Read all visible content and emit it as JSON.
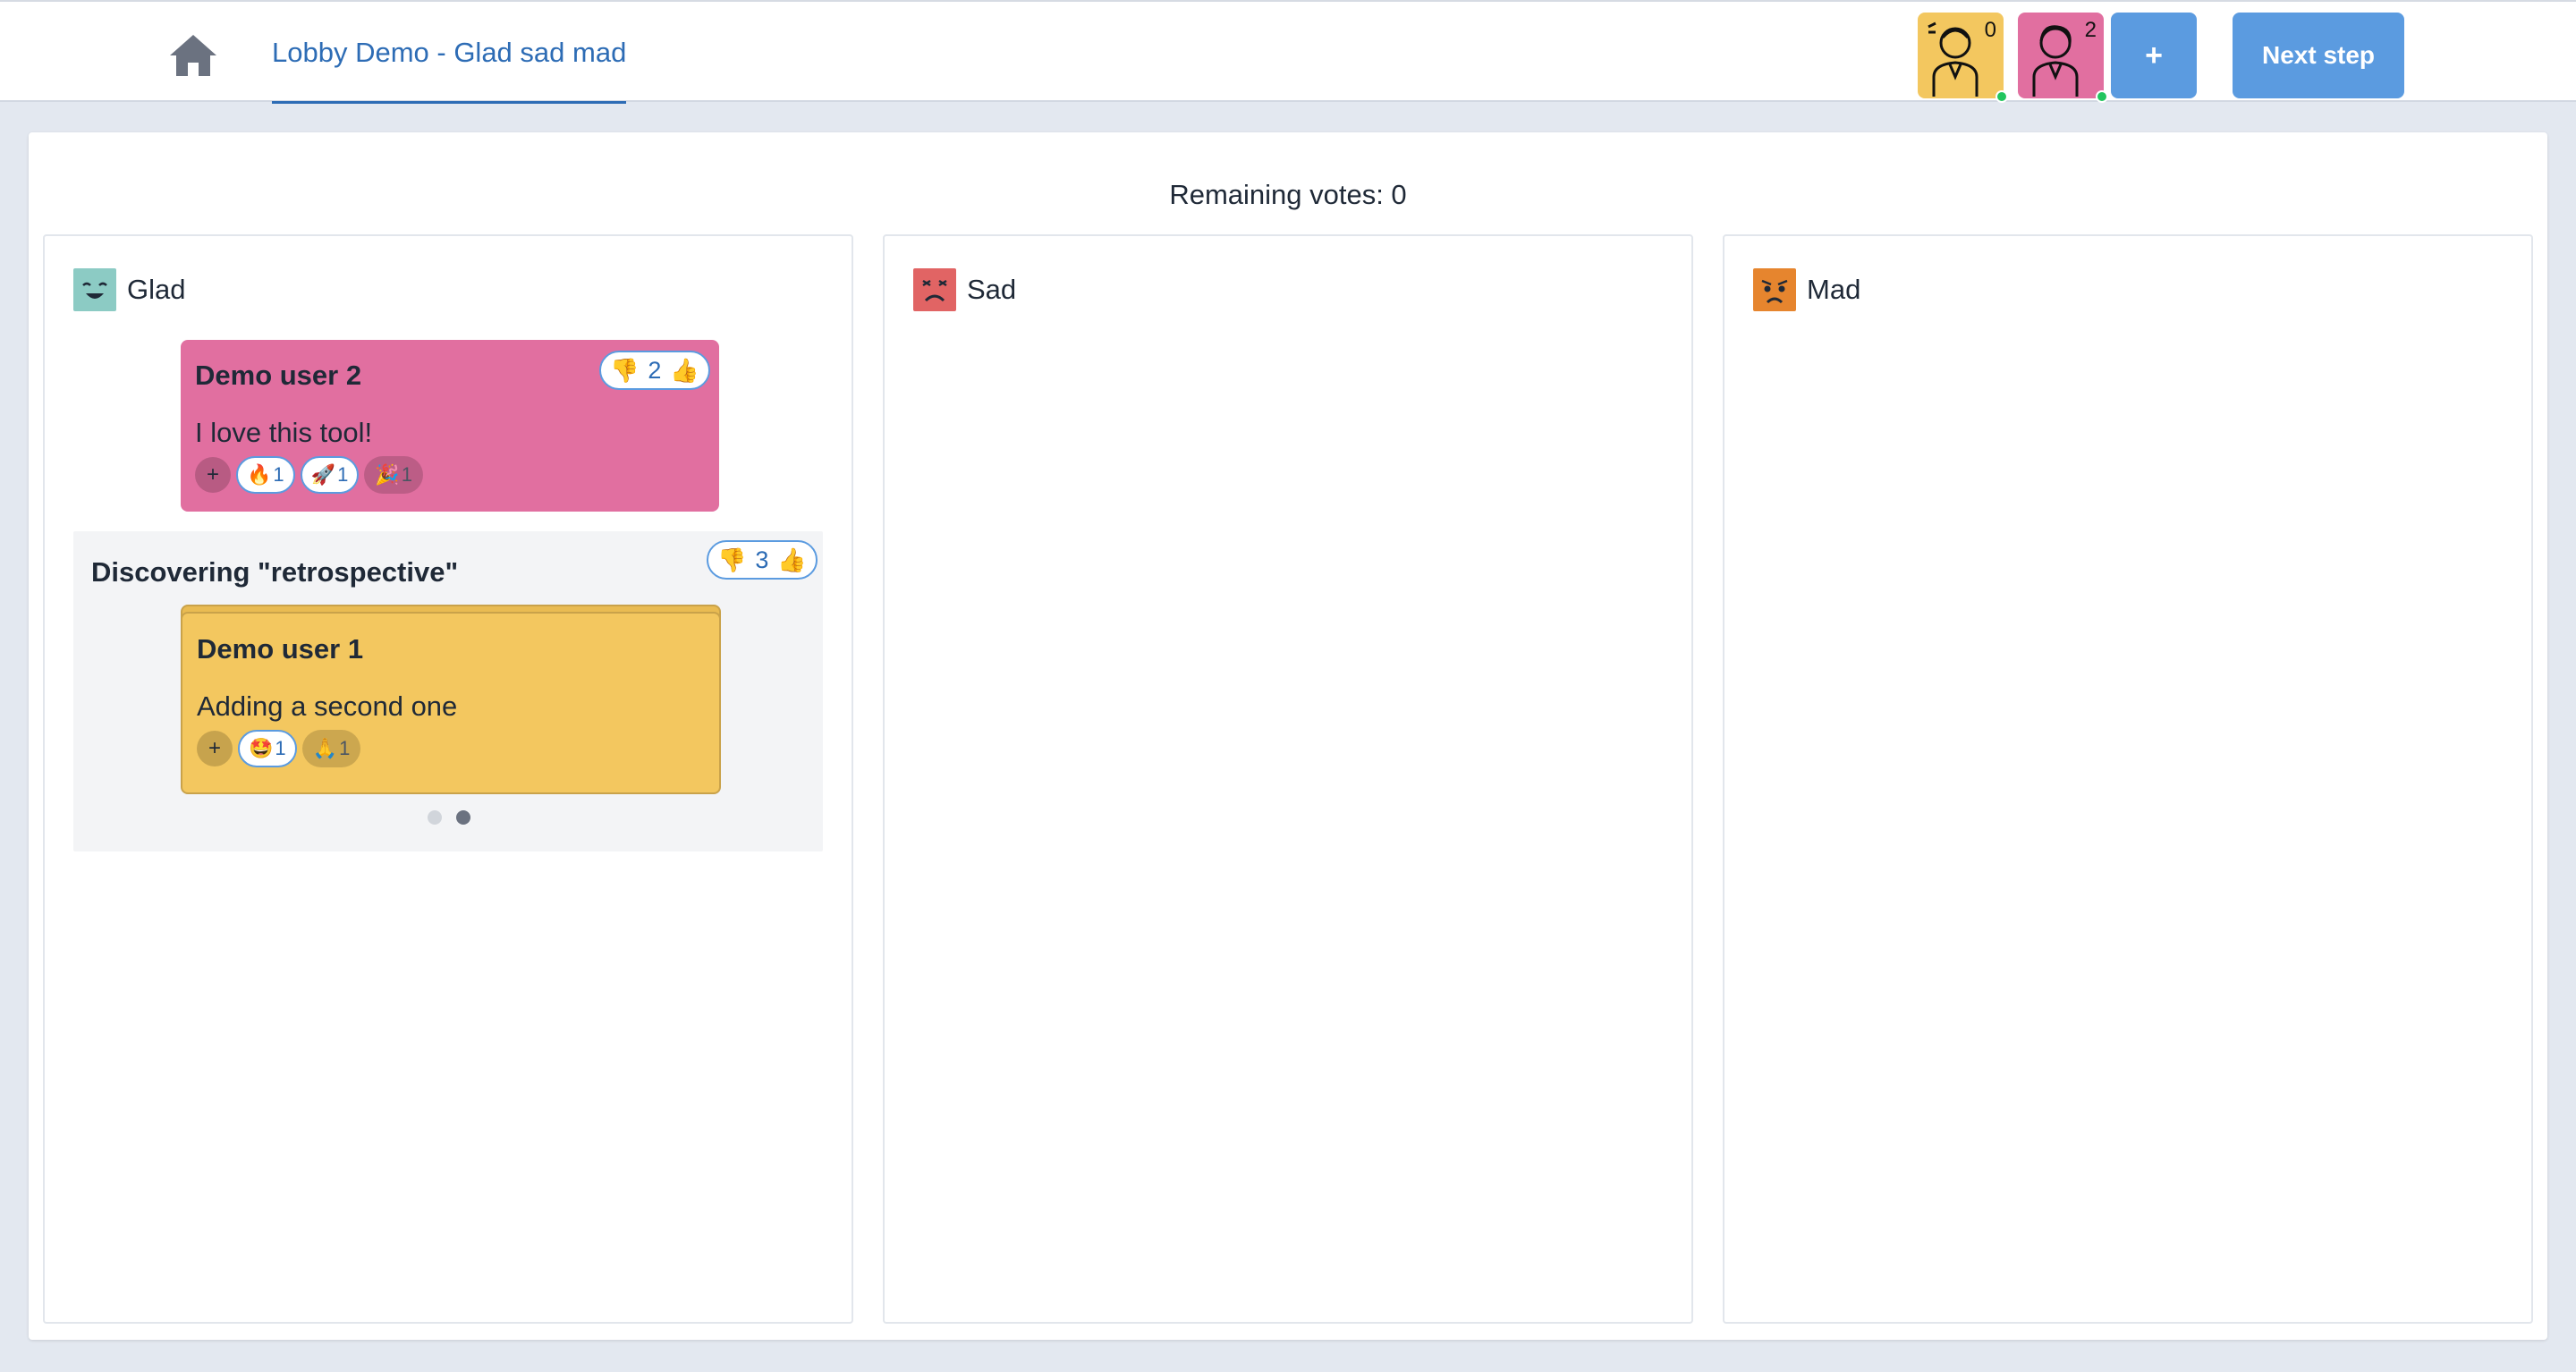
{
  "header": {
    "home_icon": "home-icon",
    "breadcrumb": "Lobby Demo - Glad sad mad",
    "participants": [
      {
        "count": "0",
        "color": "#f3c75f",
        "online": true
      },
      {
        "count": "2",
        "color": "#e16fa0",
        "online": true
      }
    ],
    "add_label": "+",
    "next_label": "Next step"
  },
  "board": {
    "remaining_votes": "Remaining votes: 0",
    "columns": [
      {
        "title": "Glad",
        "icon": "happy-face-icon",
        "color": "#8ccbc4",
        "cards": [
          {
            "author": "Demo user 2",
            "text": "I love this tool!",
            "color": "#e16fa0",
            "votes": "2",
            "reactions": [
              {
                "emoji": "🔥",
                "count": "1",
                "mine": true
              },
              {
                "emoji": "🚀",
                "count": "1",
                "mine": true
              },
              {
                "emoji": "🎉",
                "count": "1",
                "mine": false
              }
            ]
          }
        ],
        "groups": [
          {
            "title": "Discovering \"retrospective\"",
            "votes": "3",
            "card": {
              "author": "Demo user 1",
              "text": "Adding a second one",
              "color": "#f3c75f",
              "reactions": [
                {
                  "emoji": "🤩",
                  "count": "1",
                  "mine": true
                },
                {
                  "emoji": "🙏",
                  "count": "1",
                  "mine": false
                }
              ]
            },
            "pager": {
              "total": 2,
              "active": 1
            }
          }
        ]
      },
      {
        "title": "Sad",
        "icon": "sad-face-icon",
        "color": "#e16464",
        "cards": []
      },
      {
        "title": "Mad",
        "icon": "angry-face-icon",
        "color": "#e6852e",
        "cards": []
      }
    ]
  },
  "vote_icons": {
    "down": "👎",
    "up": "👍"
  },
  "colors": {
    "accent": "#5b9be0",
    "link": "#2d6cb5",
    "online": "#22c55e"
  }
}
